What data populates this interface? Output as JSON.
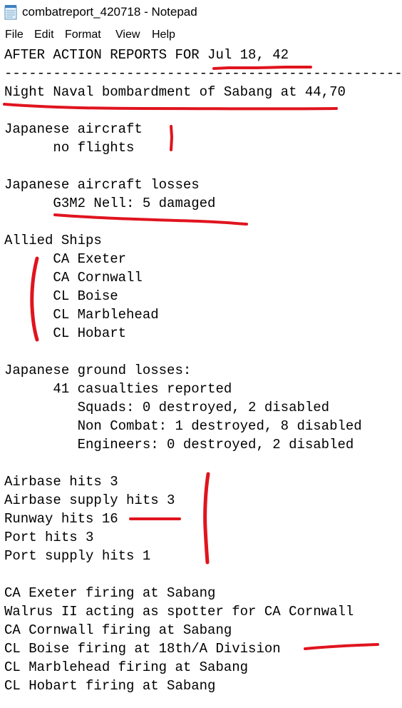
{
  "window": {
    "title": "combatreport_420718 - Notepad",
    "icon": "notepad-icon"
  },
  "menu": {
    "file": "File",
    "edit": "Edit",
    "format": "Format",
    "view": "View",
    "help": "Help"
  },
  "document": {
    "lines": [
      "AFTER ACTION REPORTS FOR Jul 18, 42",
      "--------------------------------------------------------------------------------",
      "Night Naval bombardment of Sabang at 44,70",
      "",
      "Japanese aircraft",
      "      no flights",
      "",
      "Japanese aircraft losses",
      "      G3M2 Nell: 5 damaged",
      "",
      "Allied Ships",
      "      CA Exeter",
      "      CA Cornwall",
      "      CL Boise",
      "      CL Marblehead",
      "      CL Hobart",
      "",
      "Japanese ground losses:",
      "      41 casualties reported",
      "         Squads: 0 destroyed, 2 disabled",
      "         Non Combat: 1 destroyed, 8 disabled",
      "         Engineers: 0 destroyed, 2 disabled",
      "",
      "Airbase hits 3",
      "Airbase supply hits 3",
      "Runway hits 16",
      "Port hits 3",
      "Port supply hits 1",
      "",
      "CA Exeter firing at Sabang",
      "Walrus II acting as spotter for CA Cornwall",
      "CA Cornwall firing at Sabang",
      "CL Boise firing at 18th/A Division",
      "CL Marblehead firing at Sabang",
      "CL Hobart firing at Sabang"
    ]
  },
  "colors": {
    "annotation": "#e0141e",
    "text": "#000000",
    "background": "#ffffff"
  }
}
